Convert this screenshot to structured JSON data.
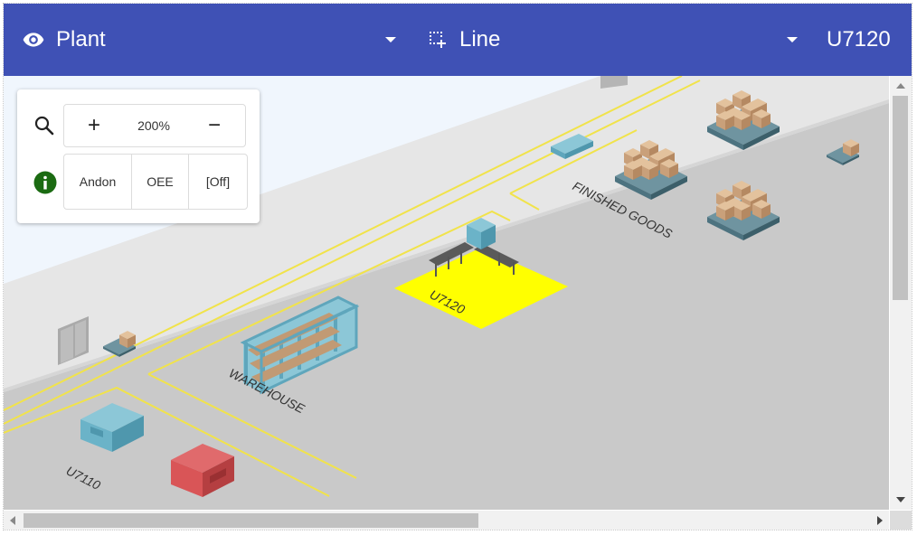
{
  "topbar": {
    "plant_label": "Plant",
    "line_label": "Line",
    "unit_label": "U7120",
    "icons": [
      "eye-icon",
      "selection-add-icon",
      "dropdown-arrow-icon"
    ]
  },
  "controls": {
    "zoom_value": "200%",
    "zoom_in_label": "+",
    "zoom_out_label": "−",
    "toggles": [
      "Andon",
      "OEE",
      "[Off]"
    ],
    "icons": [
      "search-icon",
      "info-icon"
    ]
  },
  "floor": {
    "labels": {
      "finished_goods": "FINISHED GOODS",
      "warehouse": "WAREHOUSE",
      "selected_station": "U7120",
      "station_2": "U7110"
    }
  },
  "colors": {
    "topbar": "#3f51b5",
    "highlight": "#ffff00",
    "info_icon": "#1b6b12",
    "floor": "#c9c9c9",
    "machine_blue": "#6bb3c8",
    "machine_red": "#d95557"
  }
}
